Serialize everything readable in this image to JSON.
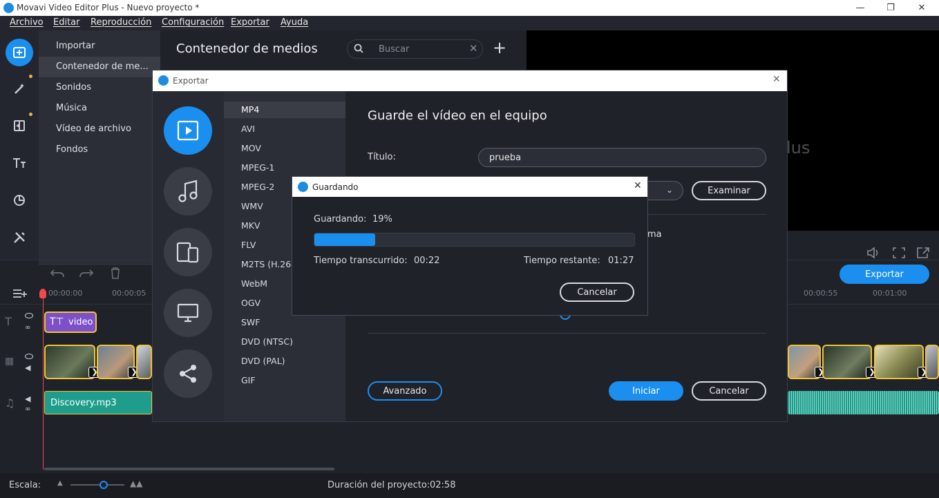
{
  "window": {
    "title": "Movavi Video Editor Plus - Nuevo proyecto *"
  },
  "menu": [
    "Archivo",
    "Editar",
    "Reproducción",
    "Configuración",
    "Exportar",
    "Ayuda"
  ],
  "sidebar": {
    "items": [
      {
        "label": "Importar",
        "active": false
      },
      {
        "label": "Contenedor de me...",
        "active": true
      },
      {
        "label": "Sonidos",
        "active": false
      },
      {
        "label": "Música",
        "active": false
      },
      {
        "label": "Vídeo de archivo",
        "active": false
      },
      {
        "label": "Fondos",
        "active": false
      }
    ]
  },
  "rail_icons": [
    "import-icon",
    "magic-wand-icon",
    "transitions-icon",
    "titles-icon",
    "stickers-icon",
    "tools-icon"
  ],
  "media": {
    "title": "Contenedor de medios",
    "search_placeholder": "Buscar"
  },
  "preview": {
    "watermark_fragment": "lus"
  },
  "timeline": {
    "export_button": "Exportar",
    "ruler": [
      "00:00:00",
      "00:00:05",
      "00:00:55",
      "00:01:00"
    ],
    "title_clip": "video",
    "audio_clip": "Discovery.mp3"
  },
  "status": {
    "scale_label": "Escala:",
    "scale_level": 0.7,
    "duration_label": "Duración del proyecto:",
    "duration_value": "02:58"
  },
  "export_dialog": {
    "title": "Exportar",
    "formats": [
      "MP4",
      "AVI",
      "MOV",
      "MPEG-1",
      "MPEG-2",
      "WMV",
      "MKV",
      "FLV",
      "M2TS (H.264)",
      "WebM",
      "OGV",
      "SWF",
      "DVD (NTSC)",
      "DVD (PAL)",
      "GIF"
    ],
    "selected_format": "MP4",
    "heading": "Guarde el vídeo en el equipo",
    "title_label": "Título:",
    "title_value": "prueba",
    "browse_button": "Examinar",
    "partial_text": "ma",
    "advanced_button": "Avanzado",
    "start_button": "Iniciar",
    "cancel_button": "Cancelar"
  },
  "saving_dialog": {
    "title": "Guardando",
    "progress_label": "Guardando:",
    "progress_text": "19%",
    "progress_fraction": 0.19,
    "elapsed_label": "Tiempo transcurrido:",
    "elapsed_value": "00:22",
    "remaining_label": "Tiempo restante:",
    "remaining_value": "01:27",
    "cancel_button": "Cancelar"
  },
  "colors": {
    "accent": "#1b8ff0",
    "clip_border": "#f0c43a",
    "audio": "#1f9d8c",
    "title_clip": "#7d4fc9"
  }
}
